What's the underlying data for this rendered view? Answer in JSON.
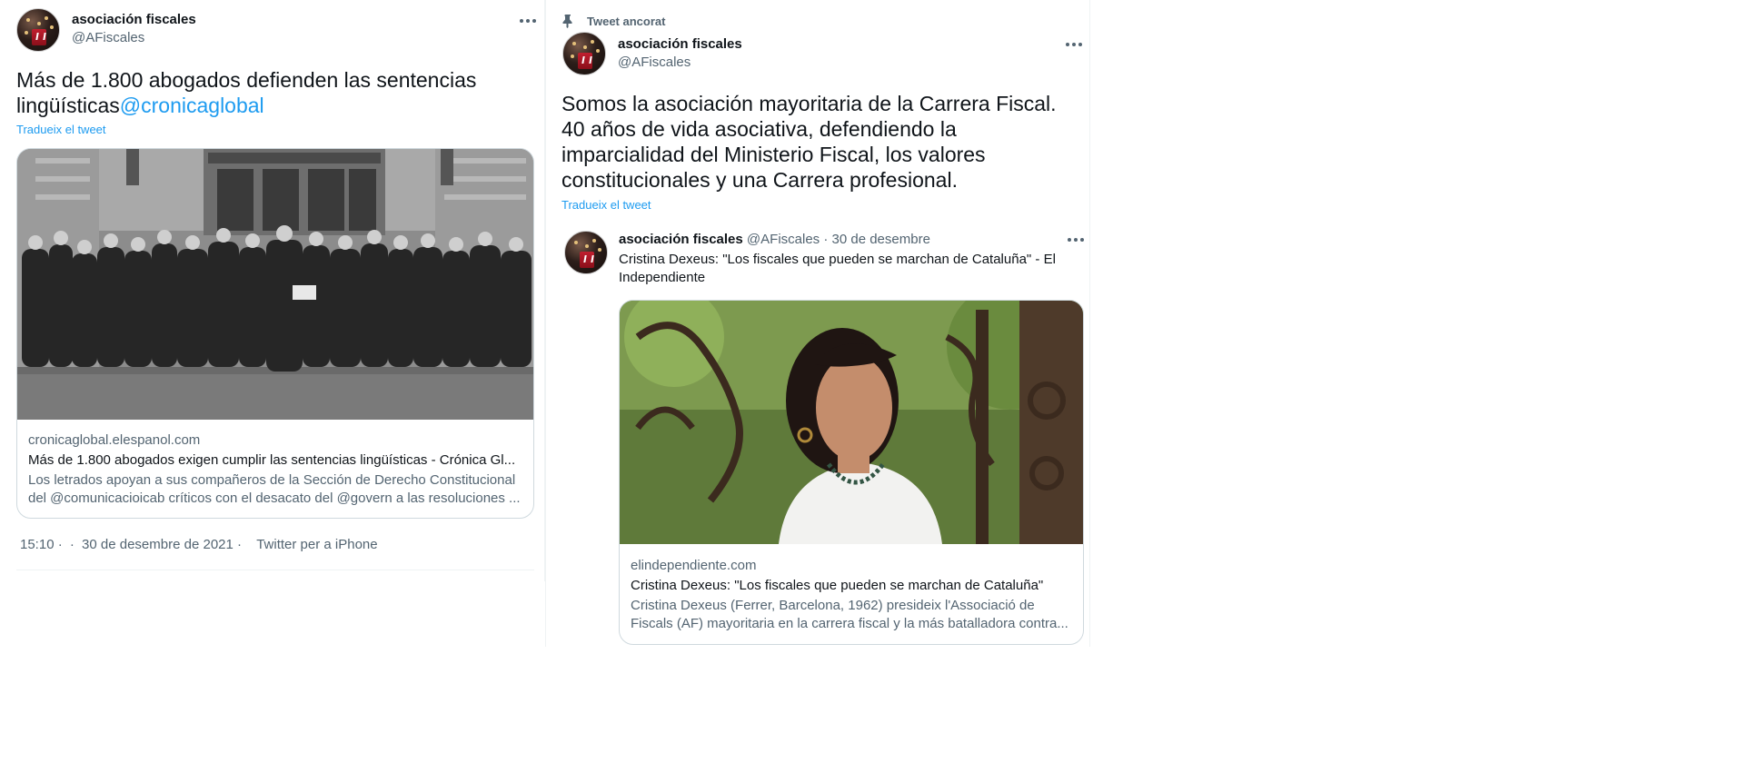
{
  "left_tweet": {
    "author": {
      "name": "asociación fiscales",
      "handle": "@AFiscales"
    },
    "text": "Más de 1.800 abogados defienden las sentencias lingüísticas",
    "mention": "@cronicaglobal",
    "translate": "Tradueix el tweet",
    "card": {
      "domain": "cronicaglobal.elespanol.com",
      "title": "Más de 1.800 abogados exigen cumplir las sentencias lingüísticas - Crónica Gl...",
      "desc_line1": "Los letrados apoyan a sus compañeros de la Sección de Derecho Constitucional",
      "desc_line2": "del @comunicacioicab críticos con el desacato del @govern a las resoluciones ..."
    },
    "footer": {
      "time": "15:10 ·",
      "sep": "·",
      "date": "30 de desembre de 2021 ·",
      "source": "Twitter per a iPhone"
    }
  },
  "right_tweet": {
    "pinned_label": "Tweet ancorat",
    "author": {
      "name": "asociación fiscales",
      "handle": "@AFiscales"
    },
    "text": "Somos la asociación mayoritaria de la Carrera Fiscal. 40 años de vida asociativa, defendiendo la imparcialidad del Ministerio Fiscal, los valores constitucionales y una Carrera profesional.",
    "translate": "Tradueix el tweet"
  },
  "quoted_tweet": {
    "author": {
      "name": "asociación fiscales",
      "handle": "@AFiscales",
      "date": "· 30 de desembre"
    },
    "text": "Cristina Dexeus: \"Los fiscales que pueden se marchan de Cataluña\" - El Independiente",
    "card": {
      "domain": "elindependiente.com",
      "title": "Cristina Dexeus: \"Los fiscales que pueden se marchan de Cataluña\"",
      "desc_line1": "Cristina Dexeus (Ferrer, Barcelona, 1962) presideix l'Associació de",
      "desc_line2": "Fiscals (AF) mayoritaria en la carrera fiscal y la más batalladora contra..."
    }
  },
  "icons": {
    "avatar": "organization-logo-avatar",
    "more": "more-options-icon",
    "pin": "pin-icon"
  },
  "colors": {
    "link": "#1d9bf0",
    "secondary_text": "#536471",
    "primary_text": "#0f1419",
    "border": "#cfd9de"
  }
}
